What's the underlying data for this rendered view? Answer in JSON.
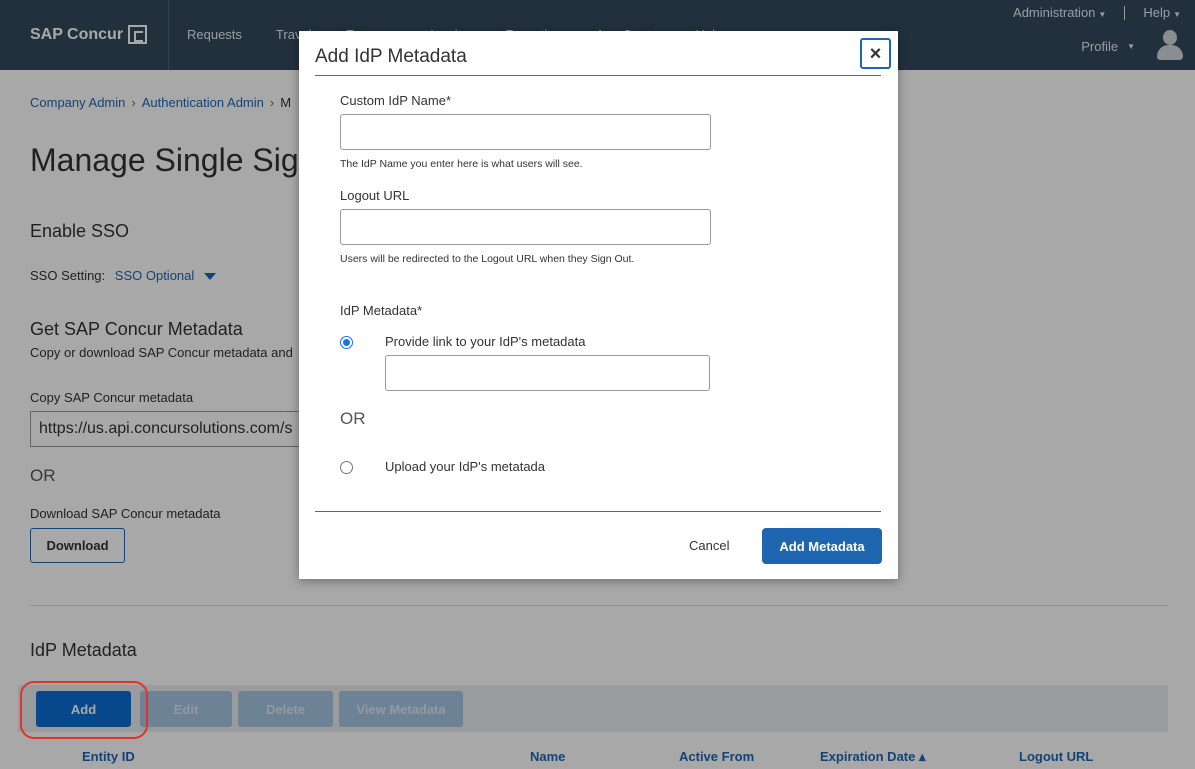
{
  "header": {
    "brand": "SAP Concur",
    "nav": [
      "Requests",
      "Travel",
      "Expense",
      "Invoice",
      "Reporting",
      "App Center",
      "Help"
    ],
    "administration": "Administration",
    "help": "Help",
    "profile": "Profile"
  },
  "breadcrumb": [
    "Company Admin",
    "Authentication Admin",
    "M"
  ],
  "page": {
    "title": "Manage Single Sign-On",
    "enable_sso": "Enable SSO",
    "sso_setting_label": "SSO Setting:",
    "sso_setting_value": "SSO Optional",
    "get_metadata": "Get SAP Concur Metadata",
    "get_metadata_desc": "Copy or download SAP Concur metadata and",
    "copy_label": "Copy SAP Concur metadata",
    "copy_value": "https://us.api.concursolutions.com/s",
    "or": "OR",
    "download_label": "Download SAP Concur metadata",
    "download_button": "Download",
    "idp_metadata": "IdP Metadata"
  },
  "toolbar": {
    "add": "Add",
    "edit": "Edit",
    "delete": "Delete",
    "view": "View Metadata"
  },
  "table": {
    "columns": [
      "Entity ID",
      "Name",
      "Active From",
      "Expiration Date ▴",
      "Logout URL"
    ]
  },
  "modal": {
    "title": "Add IdP Metadata",
    "close": "×",
    "custom_name_label": "Custom IdP Name*",
    "custom_name_value": "",
    "custom_name_help": "The IdP Name you enter here is what users will see.",
    "logout_label": "Logout URL",
    "logout_value": "",
    "logout_help": "Users will be redirected to the Logout URL when they Sign Out.",
    "metadata_label": "IdP Metadata*",
    "option_link": "Provide link to your IdP's metadata",
    "link_value": "",
    "or": "OR",
    "option_upload": "Upload your IdP's metatada",
    "cancel": "Cancel",
    "submit": "Add Metadata"
  }
}
